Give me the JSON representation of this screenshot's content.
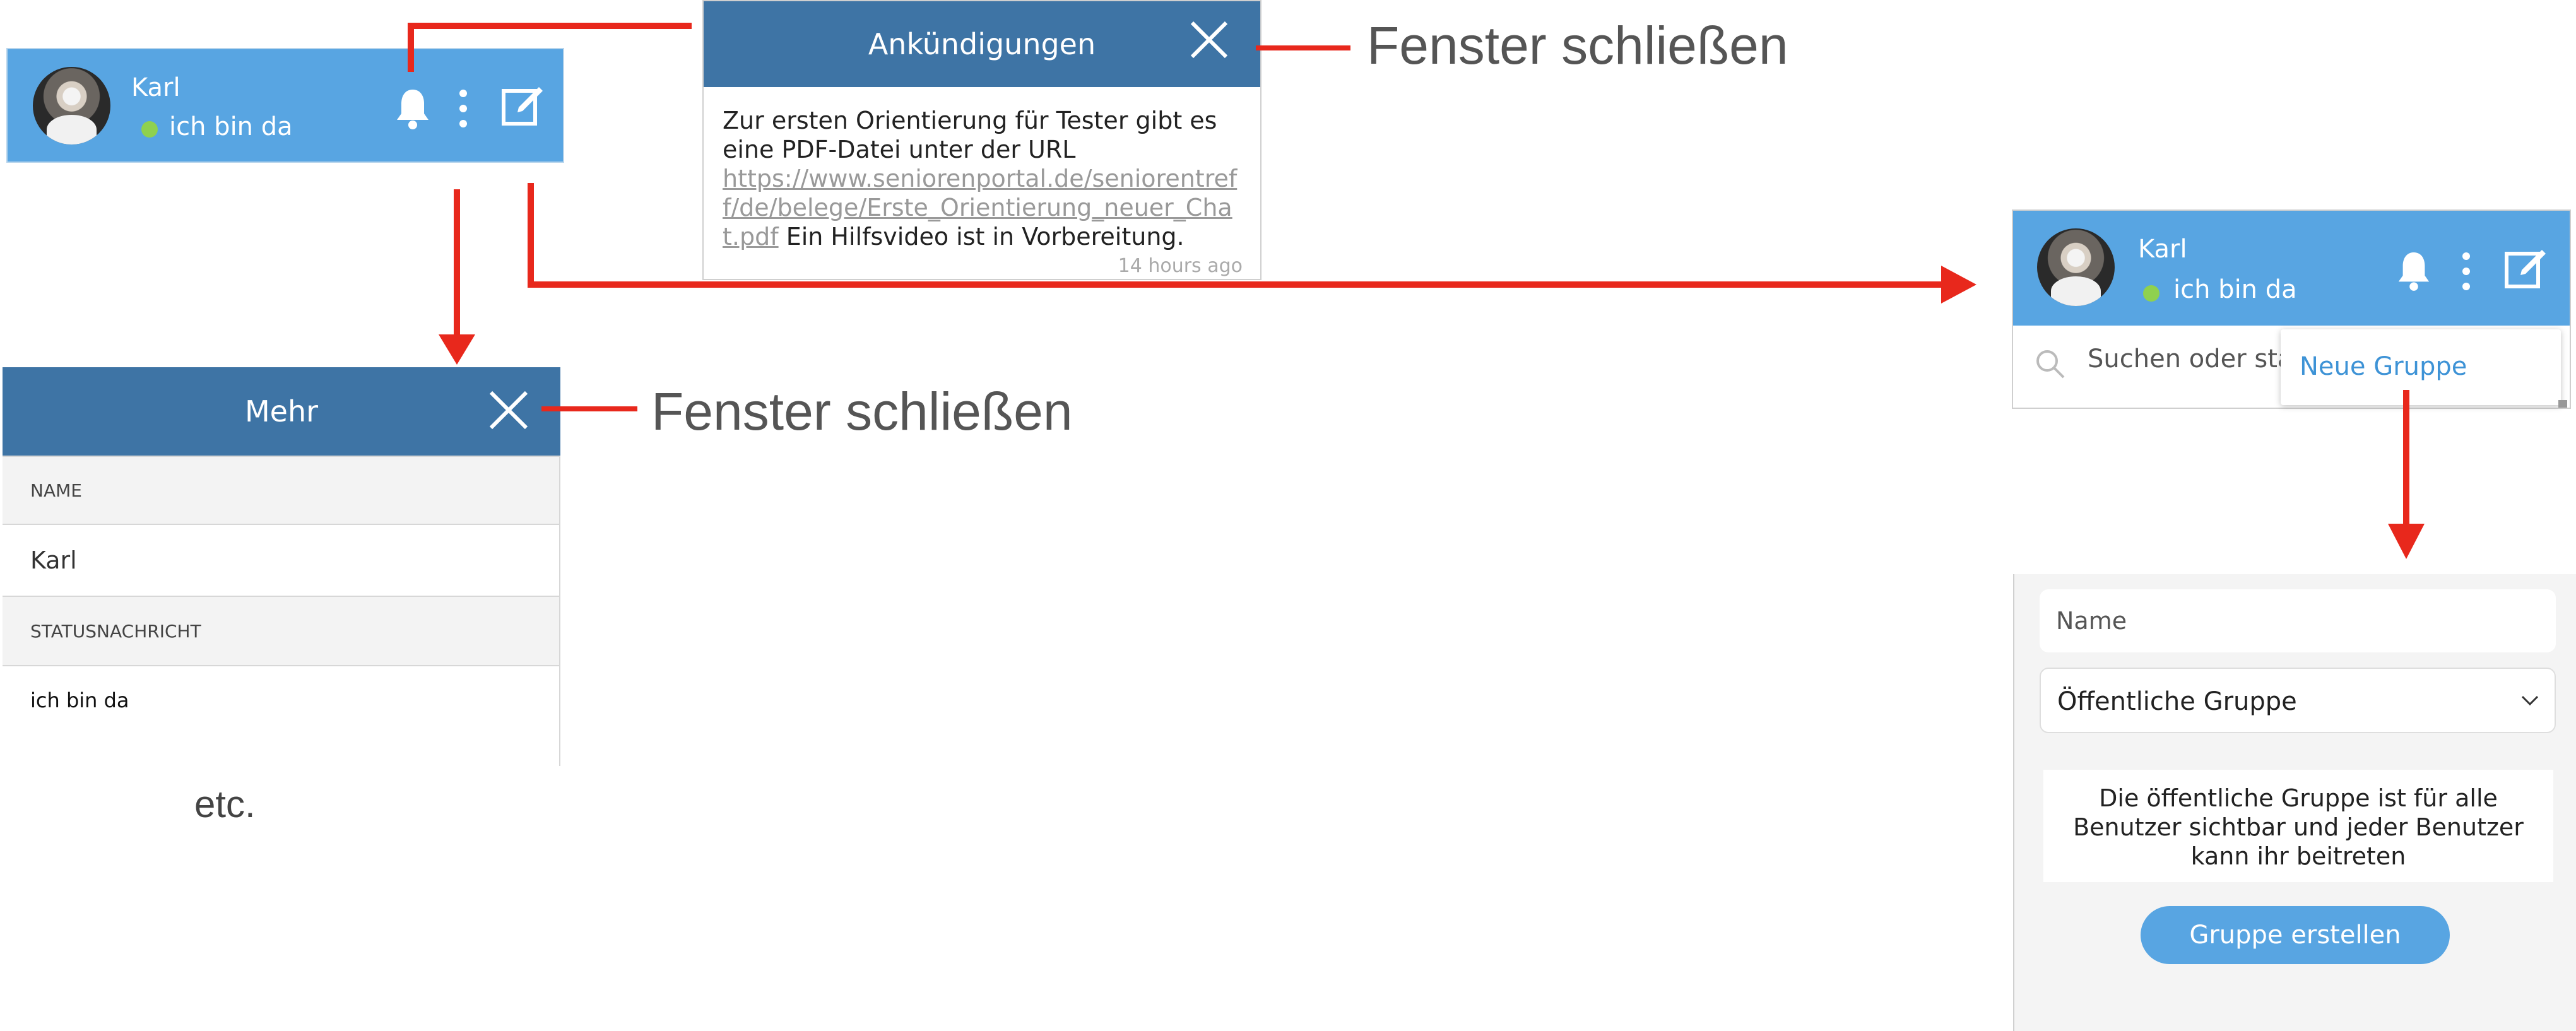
{
  "header": {
    "user_name": "Karl",
    "status": "ich bin da",
    "status_color": "#8fd14f",
    "accent": "#58a5e2",
    "icons": [
      "bell-icon",
      "more-vertical-icon",
      "compose-icon"
    ]
  },
  "announcements": {
    "title": "Ankündigungen",
    "text_before": "Zur ersten Orientierung für Tester gibt es eine PDF-Datei unter der URL",
    "link_line1": "https://www.seniorenportal.de/seniorentref",
    "link_line2": "f/de/belege/Erste_Orientierung_neuer_Cha",
    "link_line3": "t.pdf",
    "text_after": " Ein Hilfsvideo ist in Vorbereitung.",
    "time": "14 hours ago"
  },
  "annotations": {
    "close_window_1": "Fenster schließen",
    "close_window_2": "Fenster schließen",
    "etc": "etc."
  },
  "more_window": {
    "title": "Mehr",
    "name_label": "NAME",
    "name_value": "Karl",
    "status_label": "STATUSNACHRICHT",
    "status_value": "ich bin da"
  },
  "right_panel": {
    "user_name": "Karl",
    "status": "ich bin da",
    "search_placeholder": "Suchen oder sta",
    "menu_item": "Neue Gruppe"
  },
  "new_group_form": {
    "name_placeholder": "Name",
    "type_select": "Öffentliche Gruppe",
    "description": "Die öffentliche Gruppe ist für alle Benutzer sichtbar und jeder Benutzer kann ihr beitreten",
    "create_button": "Gruppe erstellen"
  }
}
